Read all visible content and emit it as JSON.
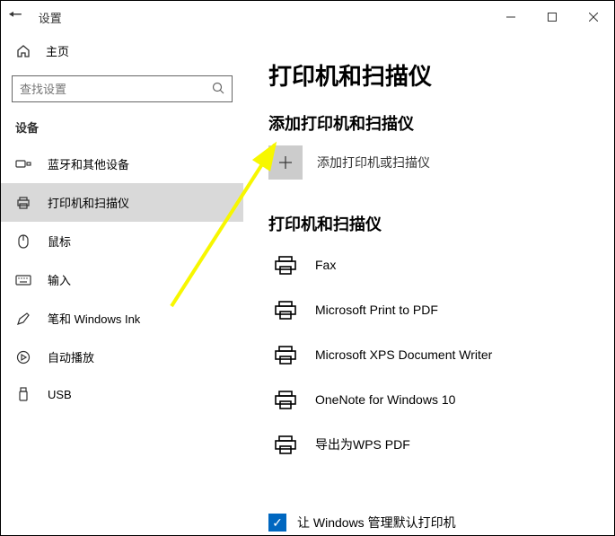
{
  "titlebar": {
    "title": "设置"
  },
  "sidebar": {
    "home": "主页",
    "search_placeholder": "查找设置",
    "category": "设备",
    "items": [
      {
        "label": "蓝牙和其他设备"
      },
      {
        "label": "打印机和扫描仪"
      },
      {
        "label": "鼠标"
      },
      {
        "label": "输入"
      },
      {
        "label": "笔和 Windows Ink"
      },
      {
        "label": "自动播放"
      },
      {
        "label": "USB"
      }
    ]
  },
  "main": {
    "page_title": "打印机和扫描仪",
    "add_section_title": "添加打印机和扫描仪",
    "add_label": "添加打印机或扫描仪",
    "list_section_title": "打印机和扫描仪",
    "printers": [
      {
        "name": "Fax"
      },
      {
        "name": "Microsoft Print to PDF"
      },
      {
        "name": "Microsoft XPS Document Writer"
      },
      {
        "name": "OneNote for Windows 10"
      },
      {
        "name": "导出为WPS PDF"
      }
    ],
    "manage_default_label": "让 Windows 管理默认打印机"
  }
}
